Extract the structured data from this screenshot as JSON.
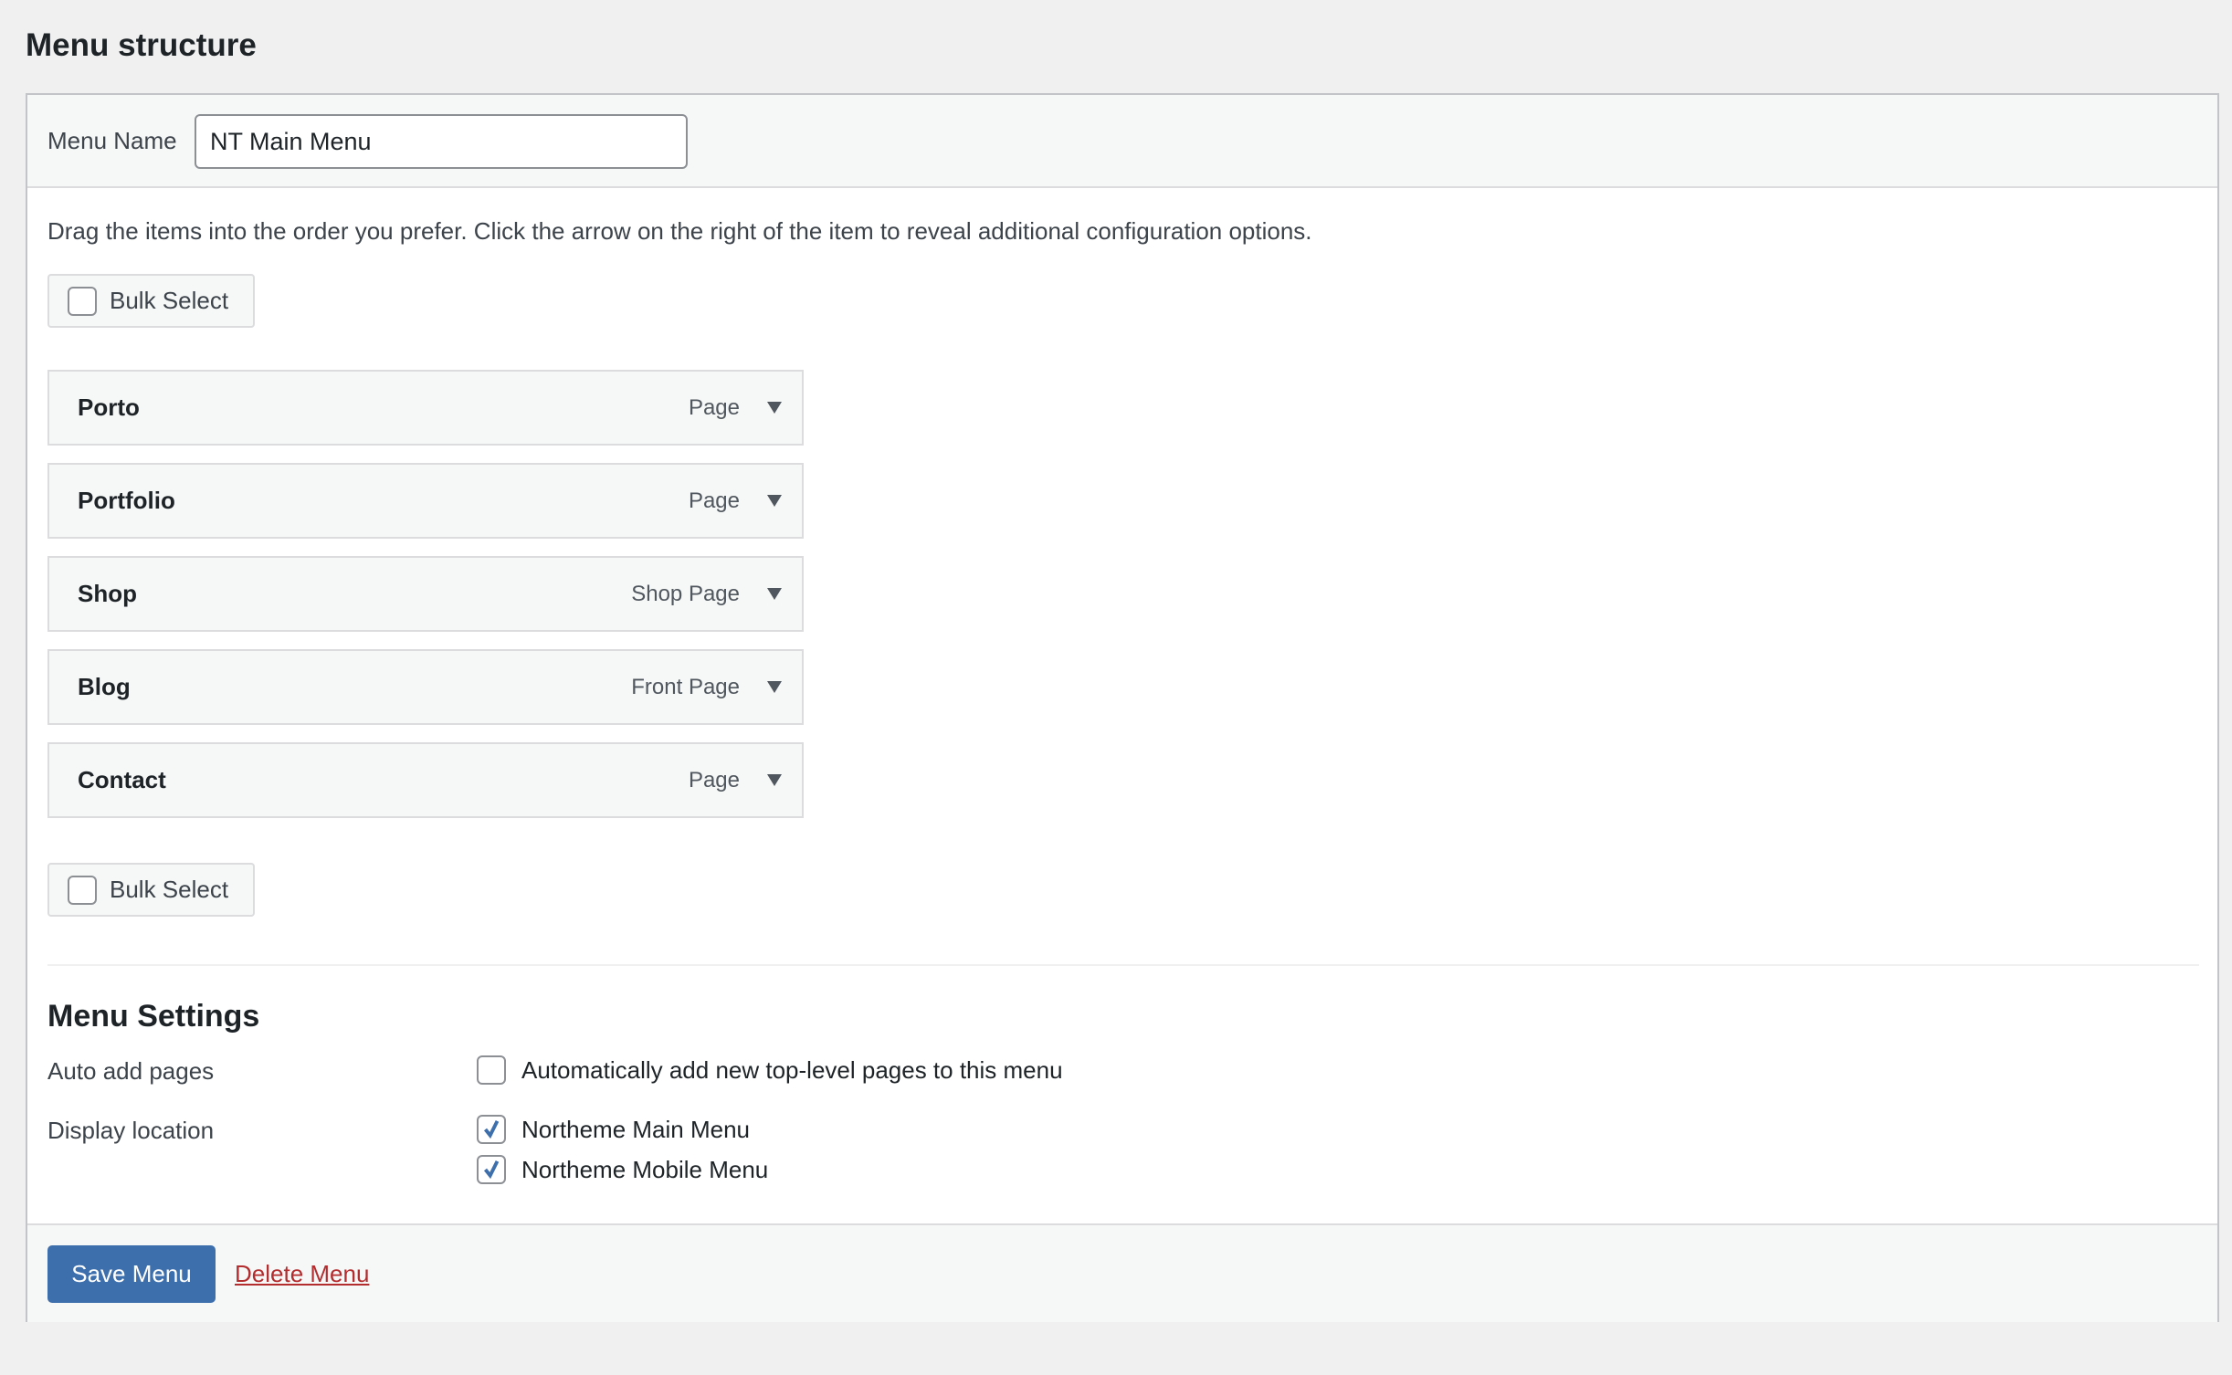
{
  "page_title": "Menu structure",
  "menu_name": {
    "label": "Menu Name",
    "value": "NT Main Menu"
  },
  "instructions": "Drag the items into the order you prefer. Click the arrow on the right of the item to reveal additional configuration options.",
  "bulk_select_label": "Bulk Select",
  "menu_items": [
    {
      "name": "Porto",
      "type": "Page"
    },
    {
      "name": "Portfolio",
      "type": "Page"
    },
    {
      "name": "Shop",
      "type": "Shop Page"
    },
    {
      "name": "Blog",
      "type": "Front Page"
    },
    {
      "name": "Contact",
      "type": "Page"
    }
  ],
  "settings": {
    "heading": "Menu Settings",
    "auto_add": {
      "label": "Auto add pages",
      "option": "Automatically add new top-level pages to this menu",
      "checked": false
    },
    "display_location": {
      "label": "Display location",
      "options": [
        {
          "label": "Northeme Main Menu",
          "checked": true
        },
        {
          "label": "Northeme Mobile Menu",
          "checked": true
        }
      ]
    }
  },
  "footer": {
    "save_label": "Save Menu",
    "delete_label": "Delete Menu"
  },
  "colors": {
    "primary": "#3e6fad",
    "danger": "#b32d2e",
    "check": "#3e6fad"
  }
}
